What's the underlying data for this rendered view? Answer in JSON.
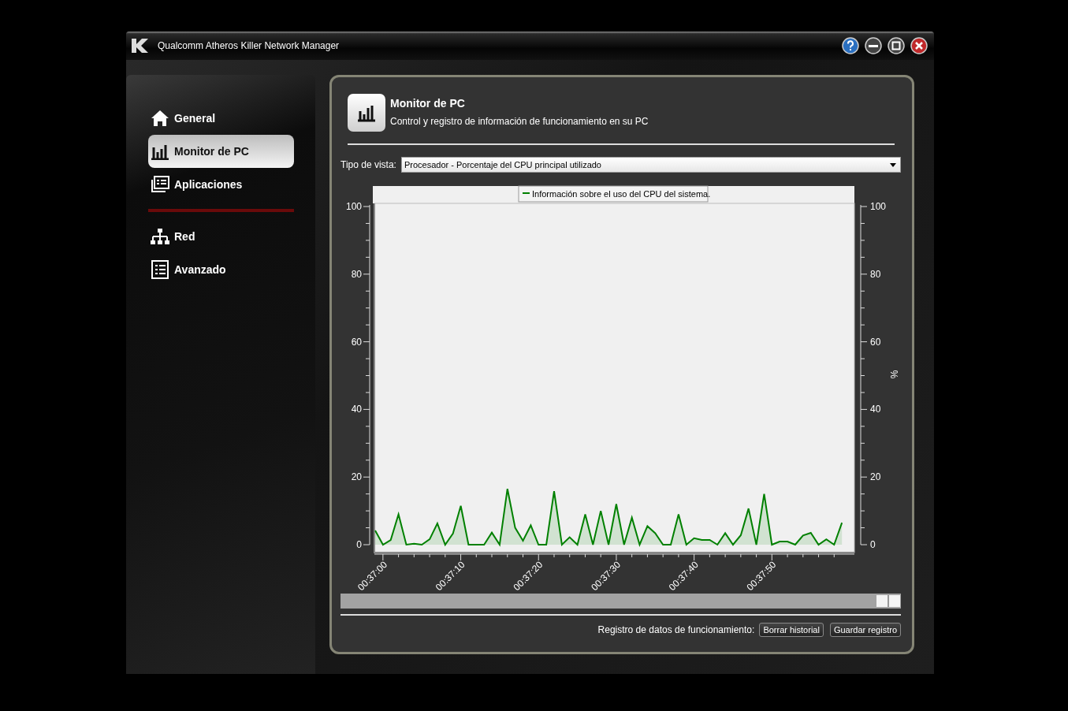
{
  "window": {
    "title": "Qualcomm Atheros Killer Network Manager"
  },
  "sidebar": {
    "groups": [
      {
        "items": [
          {
            "label": "General",
            "selected": false
          },
          {
            "label": "Monitor de PC",
            "selected": true
          },
          {
            "label": "Aplicaciones",
            "selected": false
          }
        ]
      },
      {
        "items": [
          {
            "label": "Red",
            "selected": false
          },
          {
            "label": "Avanzado",
            "selected": false
          }
        ]
      }
    ]
  },
  "page": {
    "title": "Monitor de PC",
    "subtitle": "Control y registro de información de funcionamiento en su PC"
  },
  "view_type": {
    "label": "Tipo de vista:",
    "value": "Procesador - Porcentaje del CPU principal utilizado"
  },
  "chart": {
    "chart_data": {
      "type": "area",
      "ylabel": "%",
      "categories": [
        null,
        "00:37:00",
        null,
        null,
        null,
        null,
        null,
        null,
        null,
        null,
        null,
        "00:37:10",
        null,
        null,
        null,
        null,
        null,
        null,
        null,
        null,
        null,
        "00:37:20",
        null,
        null,
        null,
        null,
        null,
        null,
        null,
        null,
        null,
        "00:37:30",
        null,
        null,
        null,
        null,
        null,
        null,
        null,
        null,
        null,
        "00:37:40",
        null,
        null,
        null,
        null,
        null,
        null,
        null,
        null,
        null,
        "00:37:50",
        null,
        null,
        null,
        null,
        null,
        null,
        null,
        null,
        null
      ],
      "series": [
        {
          "name": "Información sobre el uso del CPU del sistema.",
          "color": "#008000",
          "values": [
            4.2,
            0,
            1.4,
            9,
            0,
            0.3,
            0,
            1.6,
            6.3,
            0,
            3.3,
            11.5,
            0,
            0,
            0,
            3.6,
            0,
            16.5,
            5,
            1.2,
            5.7,
            0,
            0,
            15.8,
            0,
            2.2,
            0,
            9,
            0,
            10,
            0,
            12,
            0,
            8,
            0,
            5.5,
            3.4,
            0,
            0,
            9,
            0,
            1.9,
            1.4,
            1.4,
            0,
            3.4,
            0,
            2.8,
            10.7,
            0,
            15,
            0,
            0.9,
            0.9,
            0,
            2.7,
            3.5,
            0,
            1.6,
            0,
            6.5
          ]
        }
      ],
      "ylim": [
        0,
        100
      ],
      "yticks": [
        0,
        20,
        40,
        60,
        80,
        100
      ]
    },
    "right_axis": {
      "ticks": [
        "100",
        "80",
        "60",
        "40",
        "20",
        "0"
      ]
    }
  },
  "footer": {
    "label": "Registro de datos de funcionamiento:",
    "buttons": [
      "Borrar historial",
      "Guardar registro"
    ]
  }
}
